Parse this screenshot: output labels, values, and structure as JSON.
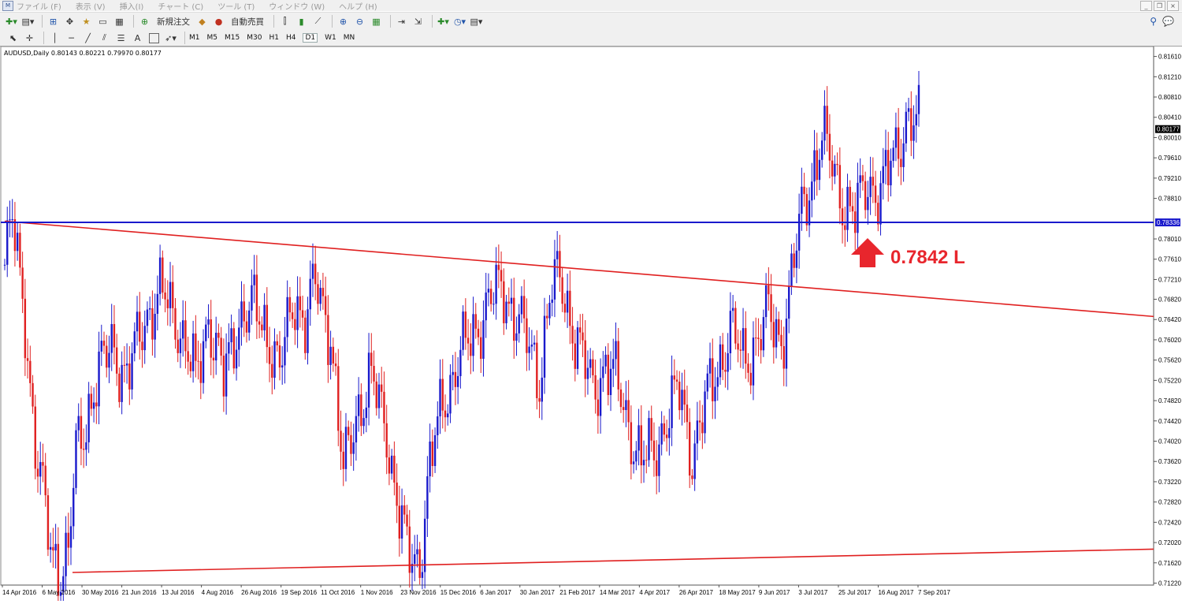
{
  "menu": [
    "ファイル (F)",
    "表示 (V)",
    "挿入(I)",
    "チャート (C)",
    "ツール (T)",
    "ウィンドウ (W)",
    "ヘルプ (H)"
  ],
  "toolbar": {
    "new_order": "新規注文",
    "auto_trade": "自動売買"
  },
  "timeframes": [
    "M1",
    "M5",
    "M15",
    "M30",
    "H1",
    "H4",
    "D1",
    "W1",
    "MN"
  ],
  "active_timeframe": "D1",
  "chart_header": "AUDUSD,Daily  0.80143 0.80221 0.79970 0.80177",
  "annotation": {
    "text": "0.7842 L",
    "color": "#e8262d"
  },
  "colors": {
    "bull": "#1a1acc",
    "bear": "#e02020",
    "hline": "#1a1acc",
    "trendline": "#e02020"
  },
  "chart_data": {
    "type": "candlestick",
    "symbol": "AUDUSD",
    "timeframe": "Daily",
    "ohlc_header": [
      0.80143,
      0.80221,
      0.7997,
      0.80177
    ],
    "current_price": "0.80177",
    "horizontal_line": "0.78336",
    "y_ticks": [
      "0.81610",
      "0.81210",
      "0.80810",
      "0.80410",
      "0.80010",
      "0.79610",
      "0.79210",
      "0.78810",
      "0.78010",
      "0.77610",
      "0.77210",
      "0.76820",
      "0.76420",
      "0.76020",
      "0.75620",
      "0.75220",
      "0.74820",
      "0.74420",
      "0.74020",
      "0.73620",
      "0.73220",
      "0.72820",
      "0.72420",
      "0.72020",
      "0.71620",
      "0.71220"
    ],
    "ylim": [
      0.7102,
      0.8181
    ],
    "x_ticks": [
      "14 Apr 2016",
      "6 May 2016",
      "30 May 2016",
      "21 Jun 2016",
      "13 Jul 2016",
      "4 Aug 2016",
      "26 Aug 2016",
      "19 Sep 2016",
      "11 Oct 2016",
      "1 Nov 2016",
      "23 Nov 2016",
      "15 Dec 2016",
      "6 Jan 2017",
      "30 Jan 2017",
      "21 Feb 2017",
      "14 Mar 2017",
      "4 Apr 2017",
      "26 Apr 2017",
      "18 May 2017",
      "9 Jun 2017",
      "3 Jul 2017",
      "25 Jul 2017",
      "16 Aug 2017",
      "7 Sep 2017"
    ],
    "path": [
      [
        0,
        0.775
      ],
      [
        3,
        0.7835
      ],
      [
        8,
        0.765
      ],
      [
        12,
        0.738
      ],
      [
        18,
        0.72
      ],
      [
        22,
        0.715
      ],
      [
        25,
        0.717
      ],
      [
        28,
        0.738
      ],
      [
        35,
        0.75
      ],
      [
        42,
        0.76
      ],
      [
        48,
        0.752
      ],
      [
        55,
        0.765
      ],
      [
        62,
        0.769
      ],
      [
        68,
        0.764
      ],
      [
        75,
        0.752
      ],
      [
        80,
        0.765
      ],
      [
        86,
        0.752
      ],
      [
        92,
        0.765
      ],
      [
        98,
        0.766
      ],
      [
        103,
        0.762
      ],
      [
        108,
        0.754
      ],
      [
        114,
        0.769
      ],
      [
        118,
        0.764
      ],
      [
        122,
        0.771
      ],
      [
        128,
        0.762
      ],
      [
        133,
        0.733
      ],
      [
        138,
        0.746
      ],
      [
        144,
        0.752
      ],
      [
        150,
        0.743
      ],
      [
        154,
        0.728
      ],
      [
        158,
        0.718
      ],
      [
        163,
        0.717
      ],
      [
        167,
        0.735
      ],
      [
        172,
        0.748
      ],
      [
        178,
        0.756
      ],
      [
        184,
        0.761
      ],
      [
        190,
        0.768
      ],
      [
        196,
        0.77
      ],
      [
        202,
        0.764
      ],
      [
        206,
        0.758
      ],
      [
        210,
        0.753
      ],
      [
        214,
        0.769
      ],
      [
        218,
        0.772
      ],
      [
        222,
        0.765
      ],
      [
        226,
        0.758
      ],
      [
        231,
        0.75
      ],
      [
        236,
        0.756
      ],
      [
        240,
        0.752
      ],
      [
        245,
        0.744
      ],
      [
        250,
        0.736
      ],
      [
        255,
        0.738
      ],
      [
        260,
        0.745
      ],
      [
        265,
        0.75
      ],
      [
        270,
        0.738
      ],
      [
        275,
        0.747
      ],
      [
        280,
        0.755
      ],
      [
        285,
        0.762
      ],
      [
        290,
        0.756
      ],
      [
        295,
        0.76
      ],
      [
        300,
        0.765
      ],
      [
        305,
        0.76
      ],
      [
        309,
        0.772
      ],
      [
        313,
        0.785
      ],
      [
        317,
        0.793
      ],
      [
        321,
        0.8
      ],
      [
        326,
        0.793
      ],
      [
        330,
        0.787
      ],
      [
        334,
        0.7842
      ],
      [
        339,
        0.792
      ],
      [
        344,
        0.789
      ],
      [
        349,
        0.796
      ],
      [
        354,
        0.804
      ],
      [
        359,
        0.8018
      ]
    ]
  }
}
